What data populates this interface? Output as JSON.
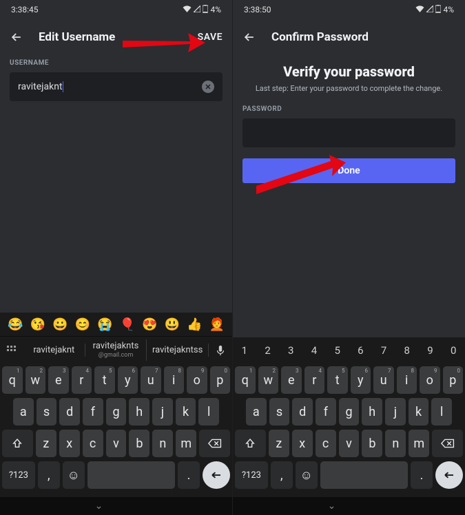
{
  "left": {
    "status": {
      "time": "3:38:45",
      "battery": "4%"
    },
    "header": {
      "title": "Edit Username",
      "save": "SAVE"
    },
    "field_label": "USERNAME",
    "input_value": "ravitejaknt",
    "suggestions": {
      "s1": "ravitejaknt",
      "s2": "ravitejaknts",
      "s2_sub": "@gmail.com",
      "s3": "ravitejakntss"
    },
    "emoji": [
      "😂",
      "😘",
      "😀",
      "😊",
      "😭",
      "🎈",
      "😍",
      "😃",
      "👍",
      "🧑‍🦰"
    ]
  },
  "right": {
    "status": {
      "time": "3:38:50",
      "battery": "4%"
    },
    "header": {
      "title": "Confirm Password"
    },
    "verify_title": "Verify your password",
    "verify_sub": "Last step: Enter your password to complete the change.",
    "field_label": "PASSWORD",
    "done": "Done",
    "numbers": [
      "1",
      "2",
      "3",
      "4",
      "5",
      "6",
      "7",
      "8",
      "9",
      "0"
    ]
  },
  "keys": {
    "row1": [
      "q",
      "w",
      "e",
      "r",
      "t",
      "y",
      "u",
      "i",
      "o",
      "p"
    ],
    "row1_sup": [
      "1",
      "2",
      "3",
      "4",
      "5",
      "6",
      "7",
      "8",
      "9",
      "0"
    ],
    "row2": [
      "a",
      "s",
      "d",
      "f",
      "g",
      "h",
      "j",
      "k",
      "l"
    ],
    "row3": [
      "z",
      "x",
      "c",
      "v",
      "b",
      "n",
      "m"
    ],
    "sym": "?123",
    "comma": ",",
    "period": "."
  }
}
